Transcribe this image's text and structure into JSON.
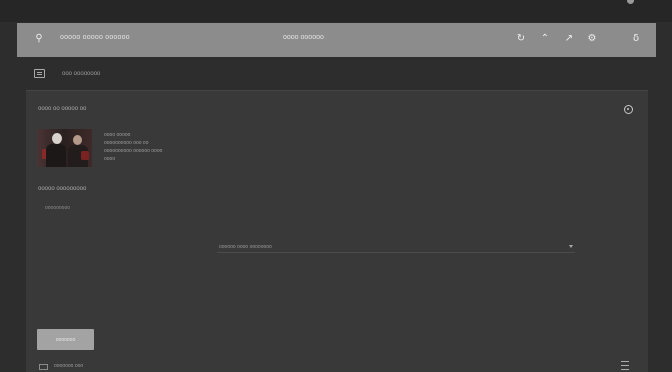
{
  "header": {
    "brand_text": "ooooo ooooo oooooo",
    "center_text": "oooo oooooo",
    "icons": [
      "refresh-icon",
      "chevron-up-icon",
      "edit-icon",
      "settings-icon",
      "translate-icon"
    ]
  },
  "subbar": {
    "text": "ooo oooooooo"
  },
  "panel": {
    "title": "oooo oo ooooo oo",
    "meta": [
      "oooo ooooo",
      "oooooooooo ooo oo",
      "oooooooooo oooooo oooo",
      "oooo"
    ],
    "section_label": "ooooo ooooooooo",
    "small_item": "ooooooooo",
    "dropdown_value": "oooooo oooo oooooooo",
    "primary_button": "ooooooo",
    "footer_text": "ooooooo ooo"
  },
  "colors": {
    "header": "#8c8c8c",
    "panel": "#393939",
    "page": "#2d2d2d",
    "button": "#a3a3a3"
  }
}
